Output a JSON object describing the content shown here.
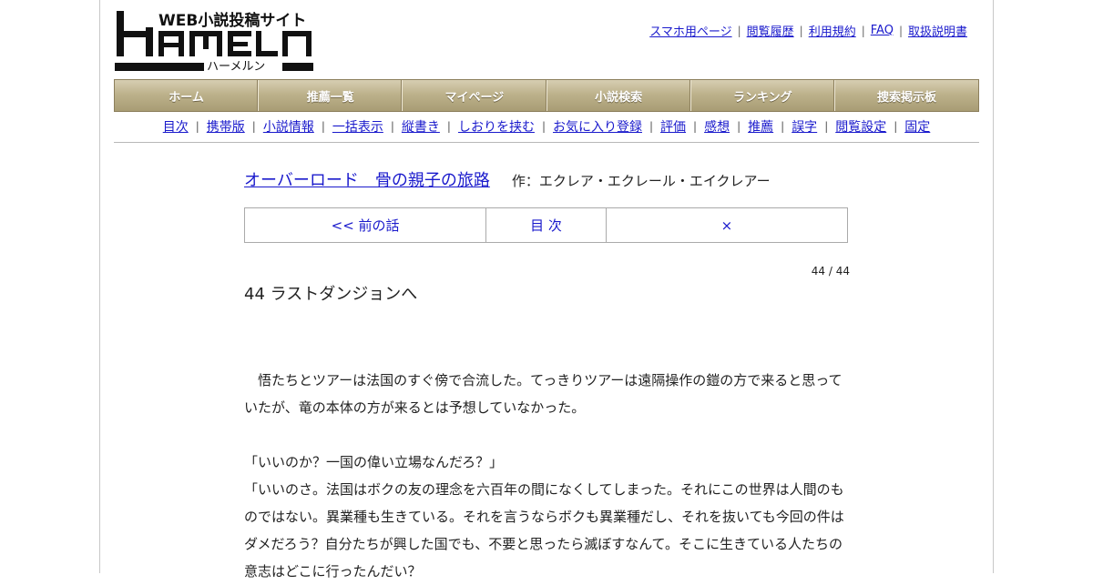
{
  "logo": {
    "tagline": "WEB小説投稿サイト",
    "name": "HAMELN",
    "kana": "ハーメルン"
  },
  "top_links": [
    "スマホ用ページ",
    "閲覧履歴",
    "利用規約",
    "FAQ",
    "取扱説明書"
  ],
  "nav": [
    "ホーム",
    "推薦一覧",
    "マイページ",
    "小説検索",
    "ランキング",
    "捜索掲示板"
  ],
  "subnav": [
    "目次",
    "携帯版",
    "小説情報",
    "一括表示",
    "縦書き",
    "しおりを挟む",
    "お気に入り登録",
    "評価",
    "感想",
    "推薦",
    "誤字",
    "閲覧設定",
    "固定"
  ],
  "novel": {
    "title": "オーバーロード　骨の親子の旅路",
    "author_prefix": "作：エクレア・エクレール・エイクレアー"
  },
  "pager": {
    "prev": "<< 前の話",
    "toc": "目 次",
    "next": "×"
  },
  "page_count": "44 / 44",
  "chapter_title": "44 ラストダンジョンへ",
  "body_lines": [
    "　悟たちとツアーは法国のすぐ傍で合流した。てっきりツアーは遠隔操作の鎧の方で来ると思って",
    "いたが、竜の本体の方が来るとは予想していなかった。",
    "",
    "「いいのか？一国の偉い立場なんだろ？」",
    "「いいのさ。法国はボクの友の理念を六百年の間になくしてしまった。それにこの世界は人間のも",
    "のではない。異業種も生きている。それを言うならボクも異業種だし、それを抜いても今回の件は",
    "ダメだろう？自分たちが興した国でも、不要と思ったら滅ぼすなんて。そこに生きている人たちの",
    "意志はどこに行ったんだい？"
  ],
  "colors": {
    "link": "#1a1acc",
    "nav_gradient_top": "#d7ceb2",
    "nav_gradient_bottom": "#a89c74",
    "nav_border": "#8c7f5c"
  }
}
